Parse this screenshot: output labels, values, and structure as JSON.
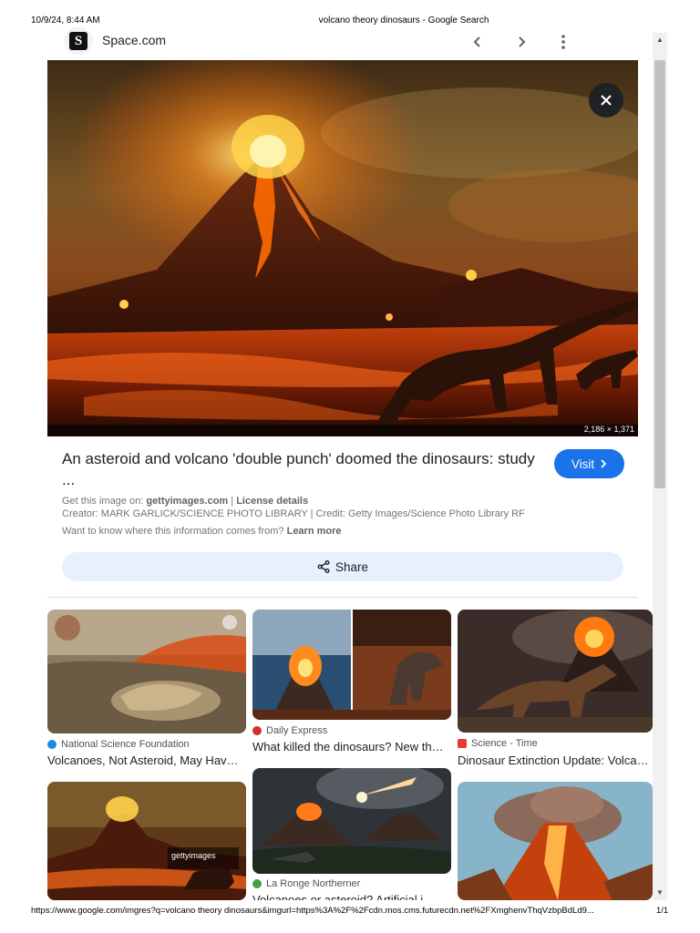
{
  "print": {
    "datetime": "10/9/24, 8:44 AM",
    "page_title": "volcano theory dinosaurs - Google Search",
    "url": "https://www.google.com/imgres?q=volcano theory dinosaurs&imgurl=https%3A%2F%2Fcdn.mos.cms.futurecdn.net%2FXmghenvThqVzbpBdLd9...",
    "page_number": "1/1"
  },
  "viewer": {
    "site_name": "Space.com",
    "site_logo_letter": "S",
    "image_dimensions": "2,186 × 1,371",
    "title": "An asteroid and volcano 'double punch' doomed the dinosaurs: study ...",
    "visit_label": "Visit",
    "get_image_prefix": "Get this image on:",
    "get_image_source": "gettyimages.com",
    "separator": "|",
    "license_label": "License details",
    "creator_line": "Creator: MARK GARLICK/SCIENCE PHOTO LIBRARY | Credit: Getty Images/Science Photo Library RF",
    "know_where_prefix": "Want to know where this information comes from?",
    "learn_more_label": "Learn more",
    "share_label": "Share"
  },
  "related": [
    {
      "source": "National Science Foundation",
      "caption": "Volcanoes, Not Asteroid, May Have Killed the ...",
      "favicon_color": "#1e88e5"
    },
    {
      "source": "Daily Express",
      "caption": "What killed the dinosaurs? New theory ...",
      "favicon_color": "#d32f2f"
    },
    {
      "source": "Science - Time",
      "caption": "Dinosaur Extinction Update: Volcanoes ...",
      "favicon_color": "#e53935"
    },
    {
      "source": "",
      "caption": "",
      "favicon_color": "#ffffff"
    },
    {
      "source": "La Ronge Northerner",
      "caption": "Volcanoes or asteroid? Artificial i...",
      "favicon_color": "#43a047"
    },
    {
      "source": "",
      "caption": "",
      "favicon_color": "#ffffff"
    }
  ],
  "watermark": "gettyimages",
  "colors": {
    "accent": "#1a73e8",
    "share_bg": "#e8f0fe"
  },
  "icons": [
    "close-icon",
    "chevron-left-icon",
    "chevron-right-icon",
    "more-vert-icon",
    "share-icon",
    "chevron-right-small-icon"
  ]
}
